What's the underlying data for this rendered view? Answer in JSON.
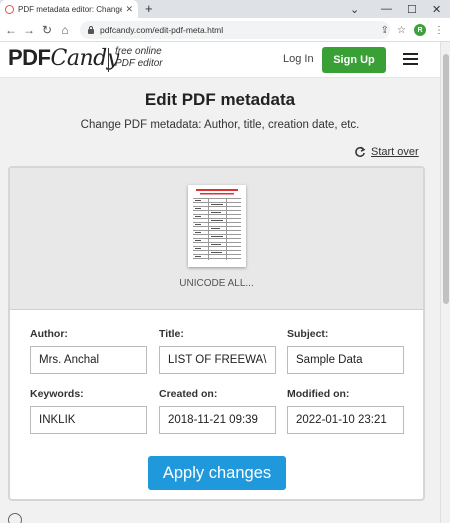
{
  "browser": {
    "tab_title": "PDF metadata editor: Change m",
    "url": "pdfcandy.com/edit-pdf-meta.html",
    "profile_initial": "R",
    "icons": {
      "back": "arrow-left-icon",
      "forward": "arrow-right-icon",
      "reload": "reload-icon",
      "home": "home-icon",
      "lock": "lock-icon",
      "share": "share-icon",
      "bookmark": "star-icon",
      "menu": "kebab-menu-icon"
    }
  },
  "header": {
    "logo_pdf": "PDF",
    "logo_candy": "Candy",
    "tagline_line1": "free online",
    "tagline_line2": "PDF editor",
    "login_label": "Log In",
    "signup_label": "Sign Up"
  },
  "main": {
    "title": "Edit PDF metadata",
    "subtitle": "Change PDF metadata: Author, title, creation date, etc.",
    "start_over_label": "Start over",
    "file_name": "UNICODE ALL...",
    "apply_label": "Apply changes"
  },
  "fields": {
    "author": {
      "label": "Author:",
      "value": "Mrs. Anchal"
    },
    "title": {
      "label": "Title:",
      "value": "LIST OF FREEWA\\"
    },
    "subject": {
      "label": "Subject:",
      "value": "Sample Data"
    },
    "keywords": {
      "label": "Keywords:",
      "value": "INKLIK"
    },
    "created": {
      "label": "Created on:",
      "value": "2018-11-21 09:39"
    },
    "modified": {
      "label": "Modified on:",
      "value": "2022-01-10 23:21"
    }
  },
  "colors": {
    "signup": "#38a035",
    "apply": "#1f98dc",
    "tab_favicon": "#e2504b"
  }
}
